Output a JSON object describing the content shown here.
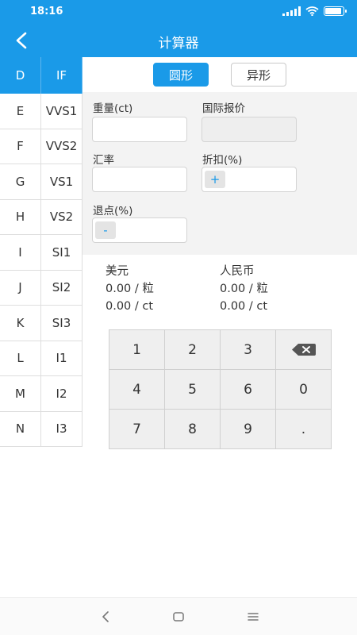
{
  "status_bar": {
    "time": "18:16",
    "battery_level": 0.9,
    "icons": [
      "signal-icon",
      "wifi-icon",
      "battery-icon"
    ]
  },
  "app_bar": {
    "title": "计算器",
    "back_icon": "back-arrow-icon"
  },
  "grades": [
    [
      "D",
      "IF"
    ],
    [
      "E",
      "VVS1"
    ],
    [
      "F",
      "VVS2"
    ],
    [
      "G",
      "VS1"
    ],
    [
      "H",
      "VS2"
    ],
    [
      "I",
      "SI1"
    ],
    [
      "J",
      "SI2"
    ],
    [
      "K",
      "SI3"
    ],
    [
      "L",
      "I1"
    ],
    [
      "M",
      "I2"
    ],
    [
      "N",
      "I3"
    ]
  ],
  "tabs": {
    "round": "圆形",
    "fancy": "异形"
  },
  "form": {
    "weight_label": "重量(ct)",
    "intl_price_label": "国际报价",
    "rate_label": "汇率",
    "discount_label": "折扣(%)",
    "discount_btn": "+",
    "rebate_label": "退点(%)",
    "rebate_btn": "-"
  },
  "results": {
    "usd_label": "美元",
    "usd_per_piece": "0.00 / 粒",
    "usd_per_ct": "0.00 / ct",
    "rmb_label": "人民币",
    "rmb_per_piece": "0.00 / 粒",
    "rmb_per_ct": "0.00 / ct"
  },
  "keypad": {
    "k1": "1",
    "k2": "2",
    "k3": "3",
    "k4": "4",
    "k5": "5",
    "k6": "6",
    "k0": "0",
    "k7": "7",
    "k8": "8",
    "k9": "9",
    "kdot": "."
  },
  "colors": {
    "primary": "#1a9ae8",
    "panel": "#f3f3f3",
    "key": "#efefef"
  }
}
